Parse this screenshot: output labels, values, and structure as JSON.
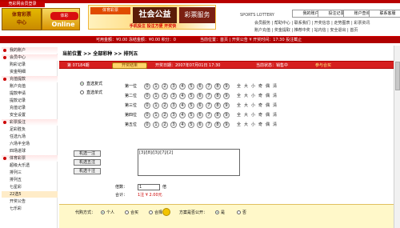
{
  "header": {
    "brand_tab": "竞彩网会员登录",
    "logo_text_1": "体育彩票",
    "logo_text_2": "中心",
    "online_red": "体彩",
    "online_text": "Online",
    "banner_a": "体育彩票",
    "banner_b": "社会公益",
    "banner_c": "彩票服务",
    "banner_d": "手机投注 投注方便 开奖快",
    "sports_logo": "SPORTS LOTTERY",
    "nav_buttons": [
      "我的账户",
      "投注记录",
      "账户查询",
      "联系客服"
    ],
    "links_1": "会员服务 | 帮助中心 | 联系我们 | 开奖信息 | 走势图表 | 彩票资讯",
    "links_2": "账户充值 | 奖金提取 | 推荐中奖 | 站内信 | 安全退出 | 首页"
  },
  "status": {
    "left": "可用金额：¥0.00  冻结金额：¥0.00  积分：0",
    "right": "当前位置：首页  |  开奖公告 ¥  开奖时间：17:30  投注截止"
  },
  "sidebar": {
    "items": [
      {
        "label": "我的账户",
        "type": "head"
      },
      {
        "label": "会员中心",
        "type": "head"
      },
      {
        "label": "购彩记录",
        "type": "item"
      },
      {
        "label": "资金明细",
        "type": "item"
      },
      {
        "label": "充值提款",
        "type": "head"
      },
      {
        "label": "账户充值",
        "type": "item"
      },
      {
        "label": "提款申请",
        "type": "item"
      },
      {
        "label": "提款记录",
        "type": "item"
      },
      {
        "label": "充值记录",
        "type": "item"
      },
      {
        "label": "安全设置",
        "type": "item"
      },
      {
        "label": "彩票投注",
        "type": "head"
      },
      {
        "label": "足彩胜负",
        "type": "item"
      },
      {
        "label": "任选九场",
        "type": "item"
      },
      {
        "label": "六场半全场",
        "type": "item"
      },
      {
        "label": "四场进球",
        "type": "item"
      },
      {
        "label": "体育彩票",
        "type": "head"
      },
      {
        "label": "超级大乐透",
        "type": "item"
      },
      {
        "label": "排列三",
        "type": "item"
      },
      {
        "label": "排列五",
        "type": "item"
      },
      {
        "label": "七星彩",
        "type": "item"
      },
      {
        "label": "22选5",
        "type": "highlight"
      },
      {
        "label": "开奖公告",
        "type": "item"
      },
      {
        "label": "七乐彩",
        "type": "item"
      }
    ]
  },
  "content": {
    "breadcrumb": "当前位置 >> 全部彩种 >> 排列五",
    "info_left": "第 07184期",
    "info_button": "开奖结果",
    "info_date": "开奖日期：2007年07月01日 17:30",
    "info_status": "当前状态：销售中",
    "info_link": "参与合买",
    "modes": [
      "直选复式",
      "直选单式"
    ],
    "row_labels": [
      "第一位",
      "第二位",
      "第三位",
      "第四位",
      "第五位"
    ],
    "digits": [
      "0",
      "1",
      "2",
      "3",
      "4",
      "5",
      "6",
      "7",
      "8",
      "9"
    ],
    "ops": [
      "全",
      "大",
      "小",
      "奇",
      "偶",
      "清"
    ],
    "actions": [
      "机选一注",
      "机选五注",
      "机选十注"
    ],
    "ticket_text": "[3]/[8]/[3]/[7]/[2]",
    "multiplier_label": "倍数：",
    "multiplier_value": "1",
    "multiplier_unit": "倍",
    "total_label": "合计：",
    "total_value": "1注  ¥ 2.00元",
    "buy_mode_label": "代购方式：",
    "buy_modes": [
      "个人",
      "合买",
      "合择"
    ],
    "follow_label": "方案是否公开：",
    "follow_options": [
      "是",
      "否"
    ]
  }
}
